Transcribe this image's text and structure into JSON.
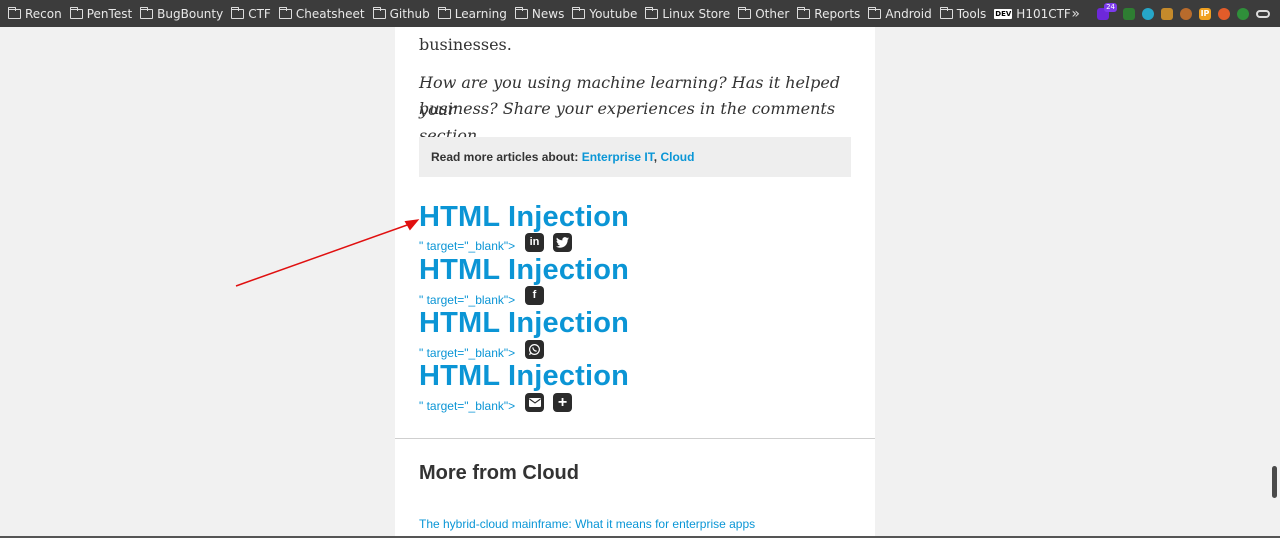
{
  "bookmarks": [
    {
      "label": "Recon"
    },
    {
      "label": "PenTest"
    },
    {
      "label": "BugBounty"
    },
    {
      "label": "CTF"
    },
    {
      "label": "Cheatsheet"
    },
    {
      "label": "Github"
    },
    {
      "label": "Learning"
    },
    {
      "label": "News"
    },
    {
      "label": "Youtube"
    },
    {
      "label": "Linux Store"
    },
    {
      "label": "Other"
    },
    {
      "label": "Reports"
    },
    {
      "label": "Android"
    },
    {
      "label": "Tools"
    }
  ],
  "dev_bookmark": {
    "badge": "DEV",
    "label": "H101CTF"
  },
  "extensions": {
    "overflow": "»",
    "badge_count": "24",
    "ip_label": "IP"
  },
  "article": {
    "para1": "businesses.",
    "para2_line1": "How are you using machine learning? Has it helped your",
    "para2_line2": "business? Share your experiences in the comments section.",
    "read_more_label": "Read more articles about: ",
    "read_more_link1": "Enterprise IT",
    "read_more_sep": ",",
    "read_more_link2": "Cloud"
  },
  "injections": [
    {
      "title": "HTML Injection",
      "tail": "\" target=\"_blank\">"
    },
    {
      "title": "HTML Injection",
      "tail": "\" target=\"_blank\">"
    },
    {
      "title": "HTML Injection",
      "tail": "\" target=\"_blank\">"
    },
    {
      "title": "HTML Injection",
      "tail": "\" target=\"_blank\">"
    }
  ],
  "share_icons": {
    "linkedin": "in",
    "facebook": "f",
    "plus": "+"
  },
  "more": {
    "heading": "More from Cloud",
    "link1": "The hybrid-cloud mainframe: What it means for enterprise apps"
  },
  "colors": {
    "link_blue": "#0b95d5",
    "annotation_arrow": "#e01010"
  }
}
